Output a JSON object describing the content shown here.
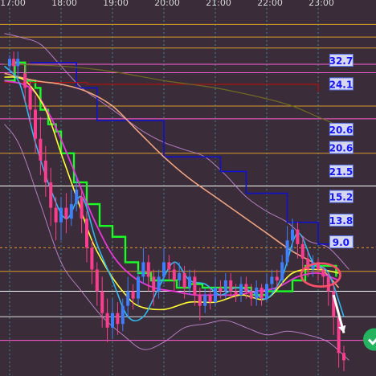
{
  "colors": {
    "background": "#3b2c39",
    "vgrid": "#35c7d3",
    "hgrid": "#c7a21e",
    "candle_up": "#3f7fff",
    "candle_down": "#ff3d8f",
    "step_green": "#19ff26",
    "step_blue": "#1111cc",
    "step_darkred": "#a11512",
    "ma_yellow": "#ffff33",
    "ma_cyan": "#2fb7ef",
    "ma_magenta": "#e637d8",
    "ma_salmon": "#f0a37f",
    "ma_olive": "#6f6a22",
    "bands": "#c98bd8",
    "level_box_bg": "#e4e7ff",
    "ellipse": "#ff4f6a",
    "arrow": "#ffffff",
    "badge": "#25b35f"
  },
  "chart_data": {
    "type": "line",
    "title": "",
    "x_tick_labels": [
      "17:00",
      "18:00",
      "19:00",
      "20:00",
      "21:00",
      "22:00",
      "23:00"
    ],
    "x_ticks": [
      0,
      1,
      2,
      3,
      4,
      5,
      6
    ],
    "x_range": [
      -0.1,
      6.7
    ],
    "y_range": [
      0,
      100
    ],
    "grid": true,
    "legend": "none",
    "level_labels": [
      {
        "text": "32.7",
        "t": 6.6,
        "v": 85.5
      },
      {
        "text": "24.1",
        "t": 6.6,
        "v": 79.0
      },
      {
        "text": "20.6",
        "t": 6.6,
        "v": 66.5
      },
      {
        "text": "20.6",
        "t": 6.6,
        "v": 61.5
      },
      {
        "text": "21.5",
        "t": 6.6,
        "v": 55.0
      },
      {
        "text": "15.2",
        "t": 6.6,
        "v": 48.0
      },
      {
        "text": "13.8",
        "t": 6.6,
        "v": 41.5
      },
      {
        "text": "9.0",
        "t": 6.6,
        "v": 35.5
      }
    ],
    "horizontal_lines": [
      {
        "v": 95.5,
        "color": "#d79a2a"
      },
      {
        "v": 92.0,
        "color": "#d79a2a"
      },
      {
        "v": 89.0,
        "color": "#d79a2a"
      },
      {
        "v": 84.5,
        "color": "#ff5fd2"
      },
      {
        "v": 82.2,
        "color": "#ff5fd2"
      },
      {
        "v": 73.0,
        "color": "#d79a2a"
      },
      {
        "v": 69.5,
        "color": "#ff5fd2"
      },
      {
        "v": 60.0,
        "color": "#d79a2a"
      },
      {
        "v": 51.0,
        "color": "#ffffff"
      },
      {
        "v": 34.0,
        "color": "#e0922a",
        "dashed": true
      },
      {
        "v": 27.5,
        "color": "#d79a2a"
      },
      {
        "v": 22.0,
        "color": "#ffffff"
      },
      {
        "v": 15.0,
        "color": "#e0e0e0"
      },
      {
        "v": 8.5,
        "color": "#ff5fd2"
      }
    ],
    "series": [
      {
        "key": "upper_band",
        "t": [
          -0.1,
          0.2,
          0.6,
          1.0,
          1.4,
          1.8,
          2.2,
          2.6,
          3.0,
          3.4,
          3.8,
          4.2,
          4.6,
          5.0,
          5.4,
          5.8,
          6.2,
          6.6
        ],
        "v": [
          93,
          92,
          90,
          84,
          78,
          74,
          70,
          66,
          63,
          61,
          59,
          54,
          48,
          44,
          41,
          36,
          34,
          28
        ]
      },
      {
        "key": "lower_band",
        "t": [
          -0.1,
          0.2,
          0.6,
          1.0,
          1.4,
          1.8,
          2.2,
          2.6,
          3.0,
          3.4,
          3.8,
          4.2,
          4.6,
          5.0,
          5.4,
          5.8,
          6.2,
          6.6
        ],
        "v": [
          68,
          62,
          46,
          30,
          22,
          15,
          10,
          6,
          8,
          12,
          13,
          14,
          12,
          10,
          11,
          10,
          8,
          3
        ]
      },
      {
        "key": "olive_ma",
        "t": [
          -0.1,
          1.0,
          2.0,
          3.0,
          4.0,
          5.0,
          5.5,
          6.0,
          6.5
        ],
        "v": [
          84.5,
          84,
          82.5,
          80,
          78,
          75,
          73,
          70,
          67
        ]
      },
      {
        "key": "salmon_ma",
        "t": [
          -0.1,
          0.5,
          1.0,
          1.5,
          2.0,
          2.5,
          3.0,
          3.5,
          4.0,
          4.5,
          5.0,
          5.5,
          6.0,
          6.4
        ],
        "v": [
          82,
          80,
          79,
          77,
          73,
          66,
          59,
          53,
          48,
          43,
          38,
          33,
          29,
          23
        ]
      },
      {
        "key": "magenta_ma",
        "t": [
          -0.1,
          0.4,
          0.8,
          1.2,
          1.6,
          2.0,
          2.4,
          2.8,
          3.2,
          3.6,
          4.0,
          4.4,
          4.8,
          5.2,
          5.6,
          6.0,
          6.4
        ],
        "v": [
          80,
          78,
          70,
          57,
          43,
          32,
          26,
          23,
          22,
          21,
          21,
          21,
          22,
          23,
          26,
          27,
          25
        ]
      },
      {
        "key": "yellow_ma",
        "t": [
          -0.1,
          0.3,
          0.7,
          1.0,
          1.3,
          1.6,
          1.9,
          2.2,
          2.5,
          3.0,
          3.5,
          4.0,
          4.5,
          5.0,
          5.5,
          6.0,
          6.4
        ],
        "v": [
          81,
          80,
          72,
          60,
          48,
          36,
          28,
          22,
          18,
          17,
          19,
          19,
          21,
          20,
          27,
          28,
          27
        ]
      },
      {
        "key": "cyan_ma",
        "t": [
          -0.1,
          0.2,
          0.5,
          0.8,
          1.1,
          1.4,
          1.7,
          2.0,
          2.3,
          2.6,
          2.9,
          3.2,
          3.5,
          3.8,
          4.1,
          4.4,
          4.7,
          5.0,
          5.3,
          5.6,
          5.9,
          6.2,
          6.5
        ],
        "v": [
          84,
          79,
          63,
          50,
          42,
          48,
          35,
          25,
          15,
          15,
          23,
          30,
          25,
          24,
          21,
          23,
          22,
          20,
          26,
          38,
          30,
          27,
          15
        ]
      }
    ],
    "steps": [
      {
        "key": "green_step",
        "t": [
          -0.1,
          0.1,
          0.3,
          0.5,
          0.6,
          0.75,
          0.9,
          1.0,
          1.25,
          1.5,
          1.75,
          2.0,
          2.25,
          2.5,
          2.75,
          3.0,
          3.25,
          3.5,
          3.75,
          4.0,
          4.5,
          4.7,
          5.0,
          5.5,
          5.75,
          6.0,
          6.35
        ],
        "v": [
          80,
          85,
          80,
          78,
          72,
          68,
          66,
          60,
          52,
          46,
          40,
          37,
          30,
          27,
          25,
          25,
          23,
          24,
          23,
          23,
          23,
          21,
          22,
          25,
          29,
          29,
          26
        ]
      },
      {
        "key": "blue_step",
        "t": [
          0.4,
          1.3,
          1.7,
          2.5,
          3.0,
          3.6,
          4.1,
          4.6,
          5.0,
          5.4,
          5.7,
          6.0,
          6.6
        ],
        "v": [
          85,
          78,
          69,
          69,
          59,
          59,
          55,
          49,
          49,
          41,
          41,
          35,
          35
        ]
      },
      {
        "key": "darkred_step",
        "t": [
          -0.1,
          1.5,
          1.5,
          6.0
        ],
        "v": [
          79.5,
          79.5,
          79,
          77
        ]
      }
    ],
    "candles": [
      {
        "t": 0.0,
        "o": 84,
        "c": 86,
        "h": 87,
        "l": 82
      },
      {
        "t": 0.08,
        "o": 86,
        "c": 84,
        "h": 88,
        "l": 82
      },
      {
        "t": 0.16,
        "o": 84,
        "c": 86,
        "h": 88,
        "l": 80
      },
      {
        "t": 0.3,
        "o": 82,
        "c": 78,
        "h": 84,
        "l": 74
      },
      {
        "t": 0.4,
        "o": 78,
        "c": 72,
        "h": 80,
        "l": 68
      },
      {
        "t": 0.5,
        "o": 72,
        "c": 64,
        "h": 76,
        "l": 60
      },
      {
        "t": 0.6,
        "o": 64,
        "c": 58,
        "h": 70,
        "l": 54
      },
      {
        "t": 0.7,
        "o": 58,
        "c": 52,
        "h": 62,
        "l": 48
      },
      {
        "t": 0.8,
        "o": 52,
        "c": 45,
        "h": 56,
        "l": 40
      },
      {
        "t": 0.9,
        "o": 45,
        "c": 41,
        "h": 48,
        "l": 36
      },
      {
        "t": 1.0,
        "o": 41,
        "c": 45,
        "h": 48,
        "l": 36
      },
      {
        "t": 1.1,
        "o": 45,
        "c": 42,
        "h": 49,
        "l": 38
      },
      {
        "t": 1.2,
        "o": 42,
        "c": 46,
        "h": 50,
        "l": 40
      },
      {
        "t": 1.3,
        "o": 46,
        "c": 50,
        "h": 54,
        "l": 44
      },
      {
        "t": 1.4,
        "o": 48,
        "c": 42,
        "h": 50,
        "l": 38
      },
      {
        "t": 1.5,
        "o": 42,
        "c": 34,
        "h": 44,
        "l": 30
      },
      {
        "t": 1.6,
        "o": 34,
        "c": 28,
        "h": 36,
        "l": 24
      },
      {
        "t": 1.7,
        "o": 28,
        "c": 22,
        "h": 30,
        "l": 18
      },
      {
        "t": 1.8,
        "o": 22,
        "c": 16,
        "h": 26,
        "l": 12
      },
      {
        "t": 1.9,
        "o": 16,
        "c": 12,
        "h": 20,
        "l": 8
      },
      {
        "t": 2.0,
        "o": 12,
        "c": 16,
        "h": 20,
        "l": 9
      },
      {
        "t": 2.1,
        "o": 16,
        "c": 13,
        "h": 19,
        "l": 10
      },
      {
        "t": 2.2,
        "o": 13,
        "c": 18,
        "h": 20,
        "l": 11
      },
      {
        "t": 2.3,
        "o": 18,
        "c": 22,
        "h": 26,
        "l": 15
      },
      {
        "t": 2.4,
        "o": 22,
        "c": 20,
        "h": 24,
        "l": 17
      },
      {
        "t": 2.5,
        "o": 20,
        "c": 26,
        "h": 28,
        "l": 18
      },
      {
        "t": 2.6,
        "o": 26,
        "c": 30,
        "h": 34,
        "l": 24
      },
      {
        "t": 2.7,
        "o": 30,
        "c": 26,
        "h": 32,
        "l": 22
      },
      {
        "t": 2.8,
        "o": 26,
        "c": 22,
        "h": 28,
        "l": 18
      },
      {
        "t": 2.9,
        "o": 22,
        "c": 26,
        "h": 28,
        "l": 20
      },
      {
        "t": 3.0,
        "o": 26,
        "c": 30,
        "h": 34,
        "l": 24
      },
      {
        "t": 3.1,
        "o": 30,
        "c": 28,
        "h": 32,
        "l": 25
      },
      {
        "t": 3.2,
        "o": 28,
        "c": 25,
        "h": 30,
        "l": 22
      },
      {
        "t": 3.3,
        "o": 25,
        "c": 27,
        "h": 30,
        "l": 23
      },
      {
        "t": 3.4,
        "o": 27,
        "c": 23,
        "h": 29,
        "l": 20
      },
      {
        "t": 3.5,
        "o": 23,
        "c": 26,
        "h": 28,
        "l": 21
      },
      {
        "t": 3.6,
        "o": 26,
        "c": 21,
        "h": 28,
        "l": 18
      },
      {
        "t": 3.7,
        "o": 21,
        "c": 18,
        "h": 23,
        "l": 14
      },
      {
        "t": 3.8,
        "o": 18,
        "c": 21,
        "h": 23,
        "l": 16
      },
      {
        "t": 3.9,
        "o": 21,
        "c": 19,
        "h": 23,
        "l": 17
      },
      {
        "t": 4.0,
        "o": 19,
        "c": 23,
        "h": 26,
        "l": 18
      },
      {
        "t": 4.1,
        "o": 23,
        "c": 22,
        "h": 25,
        "l": 20
      },
      {
        "t": 4.2,
        "o": 22,
        "c": 25,
        "h": 27,
        "l": 20
      },
      {
        "t": 4.3,
        "o": 25,
        "c": 22,
        "h": 27,
        "l": 20
      },
      {
        "t": 4.4,
        "o": 22,
        "c": 21,
        "h": 24,
        "l": 19
      },
      {
        "t": 4.5,
        "o": 21,
        "c": 24,
        "h": 26,
        "l": 19
      },
      {
        "t": 4.6,
        "o": 24,
        "c": 22,
        "h": 26,
        "l": 20
      },
      {
        "t": 4.7,
        "o": 22,
        "c": 20,
        "h": 24,
        "l": 18
      },
      {
        "t": 4.8,
        "o": 20,
        "c": 23,
        "h": 25,
        "l": 18
      },
      {
        "t": 4.9,
        "o": 23,
        "c": 20,
        "h": 24,
        "l": 18
      },
      {
        "t": 5.0,
        "o": 20,
        "c": 24,
        "h": 27,
        "l": 19
      },
      {
        "t": 5.1,
        "o": 24,
        "c": 26,
        "h": 28,
        "l": 22
      },
      {
        "t": 5.2,
        "o": 26,
        "c": 25,
        "h": 28,
        "l": 23
      },
      {
        "t": 5.3,
        "o": 25,
        "c": 30,
        "h": 32,
        "l": 24
      },
      {
        "t": 5.4,
        "o": 30,
        "c": 36,
        "h": 40,
        "l": 29
      },
      {
        "t": 5.5,
        "o": 36,
        "c": 39,
        "h": 42,
        "l": 33
      },
      {
        "t": 5.6,
        "o": 39,
        "c": 35,
        "h": 41,
        "l": 31
      },
      {
        "t": 5.7,
        "o": 35,
        "c": 31,
        "h": 37,
        "l": 28
      },
      {
        "t": 5.8,
        "o": 31,
        "c": 28,
        "h": 33,
        "l": 26
      },
      {
        "t": 5.9,
        "o": 28,
        "c": 30,
        "h": 32,
        "l": 26
      },
      {
        "t": 6.0,
        "o": 30,
        "c": 28,
        "h": 31,
        "l": 25
      },
      {
        "t": 6.1,
        "o": 28,
        "c": 26,
        "h": 29,
        "l": 23
      },
      {
        "t": 6.2,
        "o": 26,
        "c": 22,
        "h": 27,
        "l": 18
      },
      {
        "t": 6.3,
        "o": 22,
        "c": 15,
        "h": 24,
        "l": 10
      },
      {
        "t": 6.4,
        "o": 15,
        "c": 5,
        "h": 16,
        "l": 1
      },
      {
        "t": 6.5,
        "o": 5,
        "c": 3,
        "h": 7,
        "l": 0
      }
    ],
    "annotations": {
      "ellipse": {
        "t": 6.05,
        "v": 26.5,
        "rt": 0.38,
        "rv": 3.2
      },
      "arrow": {
        "t1": 6.3,
        "v1": 21,
        "t2": 6.5,
        "v2": 10.5
      }
    }
  }
}
